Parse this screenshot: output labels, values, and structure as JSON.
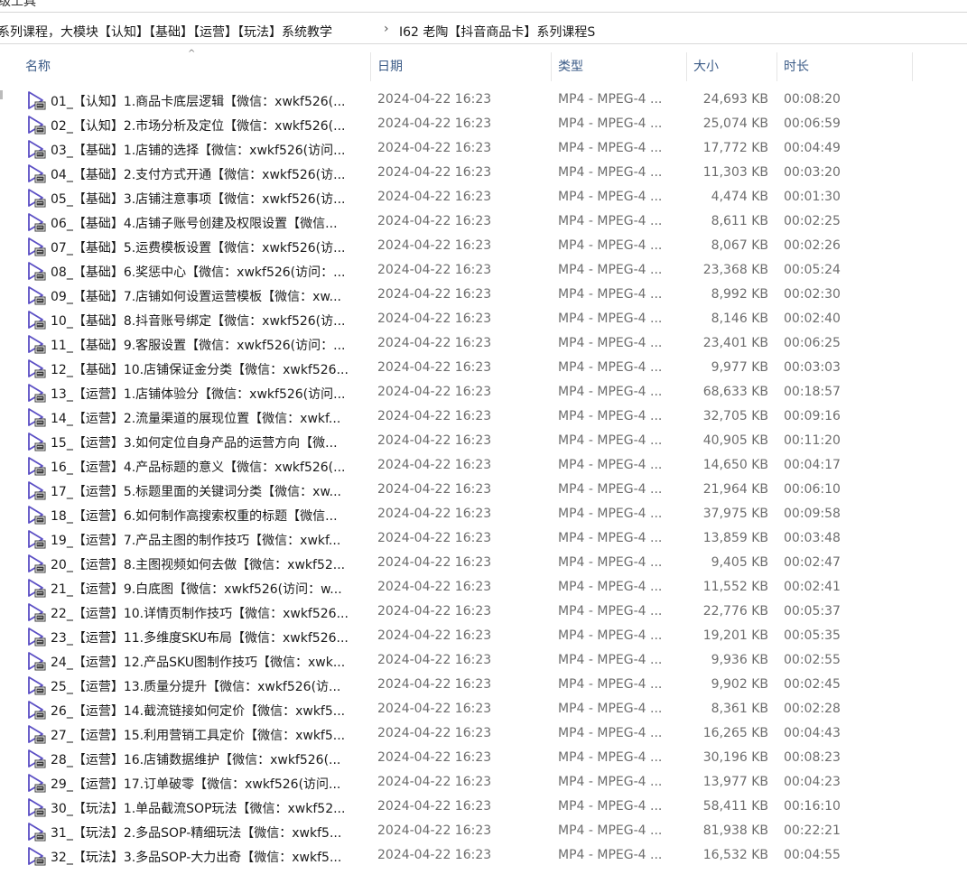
{
  "window": {
    "top_strip_text": "级工具"
  },
  "address": {
    "crumb_parent": "系列课程，大模块【认知】【基础】【运营】【玩法】系统教学",
    "crumb_current": "I62 老陶【抖音商品卡】系列课程S",
    "separator": "›"
  },
  "columns": {
    "name": "名称",
    "date": "日期",
    "type": "类型",
    "size": "大小",
    "duration": "时长",
    "sort_indicator": "^"
  },
  "icons": {
    "file": "video-file-icon",
    "sort": "sort-ascending-icon",
    "separator": "chevron-right-icon"
  },
  "colors": {
    "header_text": "#3b5b87",
    "icon": "#5b4fc4",
    "muted_text": "#6d6d6d"
  },
  "files": [
    {
      "name": "01_【认知】1.商品卡底层逻辑【微信：xwkf526(...",
      "date": "2024-04-22 16:23",
      "type": "MP4 - MPEG-4 ...",
      "size": "24,693 KB",
      "duration": "00:08:20"
    },
    {
      "name": "02_【认知】2.市场分析及定位【微信：xwkf526(...",
      "date": "2024-04-22 16:23",
      "type": "MP4 - MPEG-4 ...",
      "size": "25,074 KB",
      "duration": "00:06:59"
    },
    {
      "name": "03_【基础】1.店铺的选择【微信：xwkf526(访问...",
      "date": "2024-04-22 16:23",
      "type": "MP4 - MPEG-4 ...",
      "size": "17,772 KB",
      "duration": "00:04:49"
    },
    {
      "name": "04_【基础】2.支付方式开通【微信：xwkf526(访...",
      "date": "2024-04-22 16:23",
      "type": "MP4 - MPEG-4 ...",
      "size": "11,303 KB",
      "duration": "00:03:20"
    },
    {
      "name": "05_【基础】3.店铺注意事项【微信：xwkf526(访...",
      "date": "2024-04-22 16:23",
      "type": "MP4 - MPEG-4 ...",
      "size": "4,474 KB",
      "duration": "00:01:30"
    },
    {
      "name": "06_【基础】4.店铺子账号创建及权限设置【微信...",
      "date": "2024-04-22 16:23",
      "type": "MP4 - MPEG-4 ...",
      "size": "8,611 KB",
      "duration": "00:02:25"
    },
    {
      "name": "07_【基础】5.运费模板设置【微信：xwkf526(访...",
      "date": "2024-04-22 16:23",
      "type": "MP4 - MPEG-4 ...",
      "size": "8,067 KB",
      "duration": "00:02:26"
    },
    {
      "name": "08_【基础】6.奖惩中心【微信：xwkf526(访问：...",
      "date": "2024-04-22 16:23",
      "type": "MP4 - MPEG-4 ...",
      "size": "23,368 KB",
      "duration": "00:05:24"
    },
    {
      "name": "09_【基础】7.店铺如何设置运营模板【微信：xw...",
      "date": "2024-04-22 16:23",
      "type": "MP4 - MPEG-4 ...",
      "size": "8,992 KB",
      "duration": "00:02:30"
    },
    {
      "name": "10_【基础】8.抖音账号绑定【微信：xwkf526(访...",
      "date": "2024-04-22 16:23",
      "type": "MP4 - MPEG-4 ...",
      "size": "8,146 KB",
      "duration": "00:02:40"
    },
    {
      "name": "11_【基础】9.客服设置【微信：xwkf526(访问：...",
      "date": "2024-04-22 16:23",
      "type": "MP4 - MPEG-4 ...",
      "size": "23,401 KB",
      "duration": "00:06:25"
    },
    {
      "name": "12_【基础】10.店铺保证金分类【微信：xwkf526...",
      "date": "2024-04-22 16:23",
      "type": "MP4 - MPEG-4 ...",
      "size": "9,977 KB",
      "duration": "00:03:03"
    },
    {
      "name": "13_【运营】1.店铺体验分【微信：xwkf526(访问...",
      "date": "2024-04-22 16:23",
      "type": "MP4 - MPEG-4 ...",
      "size": "68,633 KB",
      "duration": "00:18:57"
    },
    {
      "name": "14_【运营】2.流量渠道的展现位置【微信：xwkf...",
      "date": "2024-04-22 16:23",
      "type": "MP4 - MPEG-4 ...",
      "size": "32,705 KB",
      "duration": "00:09:16"
    },
    {
      "name": "15_【运营】3.如何定位自身产品的运营方向【微...",
      "date": "2024-04-22 16:23",
      "type": "MP4 - MPEG-4 ...",
      "size": "40,905 KB",
      "duration": "00:11:20"
    },
    {
      "name": "16_【运营】4.产品标题的意义【微信：xwkf526(...",
      "date": "2024-04-22 16:23",
      "type": "MP4 - MPEG-4 ...",
      "size": "14,650 KB",
      "duration": "00:04:17"
    },
    {
      "name": "17_【运营】5.标题里面的关键词分类【微信：xw...",
      "date": "2024-04-22 16:23",
      "type": "MP4 - MPEG-4 ...",
      "size": "21,964 KB",
      "duration": "00:06:10"
    },
    {
      "name": "18_【运营】6.如何制作高搜索权重的标题【微信...",
      "date": "2024-04-22 16:23",
      "type": "MP4 - MPEG-4 ...",
      "size": "37,975 KB",
      "duration": "00:09:58"
    },
    {
      "name": "19_【运营】7.产品主图的制作技巧【微信：xwkf...",
      "date": "2024-04-22 16:23",
      "type": "MP4 - MPEG-4 ...",
      "size": "13,859 KB",
      "duration": "00:03:48"
    },
    {
      "name": "20_【运营】8.主图视频如何去做【微信：xwkf52...",
      "date": "2024-04-22 16:23",
      "type": "MP4 - MPEG-4 ...",
      "size": "9,405 KB",
      "duration": "00:02:47"
    },
    {
      "name": "21_【运营】9.白底图【微信：xwkf526(访问：w...",
      "date": "2024-04-22 16:23",
      "type": "MP4 - MPEG-4 ...",
      "size": "11,552 KB",
      "duration": "00:02:41"
    },
    {
      "name": "22_【运营】10.详情页制作技巧【微信：xwkf526...",
      "date": "2024-04-22 16:23",
      "type": "MP4 - MPEG-4 ...",
      "size": "22,776 KB",
      "duration": "00:05:37"
    },
    {
      "name": "23_【运营】11.多维度SKU布局【微信：xwkf526...",
      "date": "2024-04-22 16:23",
      "type": "MP4 - MPEG-4 ...",
      "size": "19,201 KB",
      "duration": "00:05:35"
    },
    {
      "name": "24_【运营】12.产品SKU图制作技巧【微信：xwk...",
      "date": "2024-04-22 16:23",
      "type": "MP4 - MPEG-4 ...",
      "size": "9,936 KB",
      "duration": "00:02:55"
    },
    {
      "name": "25_【运营】13.质量分提升【微信：xwkf526(访...",
      "date": "2024-04-22 16:23",
      "type": "MP4 - MPEG-4 ...",
      "size": "9,902 KB",
      "duration": "00:02:45"
    },
    {
      "name": "26_【运营】14.截流链接如何定价【微信：xwkf5...",
      "date": "2024-04-22 16:23",
      "type": "MP4 - MPEG-4 ...",
      "size": "8,361 KB",
      "duration": "00:02:28"
    },
    {
      "name": "27_【运营】15.利用营销工具定价【微信：xwkf5...",
      "date": "2024-04-22 16:23",
      "type": "MP4 - MPEG-4 ...",
      "size": "16,265 KB",
      "duration": "00:04:43"
    },
    {
      "name": "28_【运营】16.店铺数据维护【微信：xwkf526(...",
      "date": "2024-04-22 16:23",
      "type": "MP4 - MPEG-4 ...",
      "size": "30,196 KB",
      "duration": "00:08:23"
    },
    {
      "name": "29_【运营】17.订单破零【微信：xwkf526(访问...",
      "date": "2024-04-22 16:23",
      "type": "MP4 - MPEG-4 ...",
      "size": "13,977 KB",
      "duration": "00:04:23"
    },
    {
      "name": "30_【玩法】1.单品截流SOP玩法【微信：xwkf52...",
      "date": "2024-04-22 16:23",
      "type": "MP4 - MPEG-4 ...",
      "size": "58,411 KB",
      "duration": "00:16:10"
    },
    {
      "name": "31_【玩法】2.多品SOP-精细玩法【微信：xwkf5...",
      "date": "2024-04-22 16:23",
      "type": "MP4 - MPEG-4 ...",
      "size": "81,938 KB",
      "duration": "00:22:21"
    },
    {
      "name": "32_【玩法】3.多品SOP-大力出奇【微信：xwkf5...",
      "date": "2024-04-22 16:23",
      "type": "MP4 - MPEG-4 ...",
      "size": "16,532 KB",
      "duration": "00:04:55"
    }
  ]
}
